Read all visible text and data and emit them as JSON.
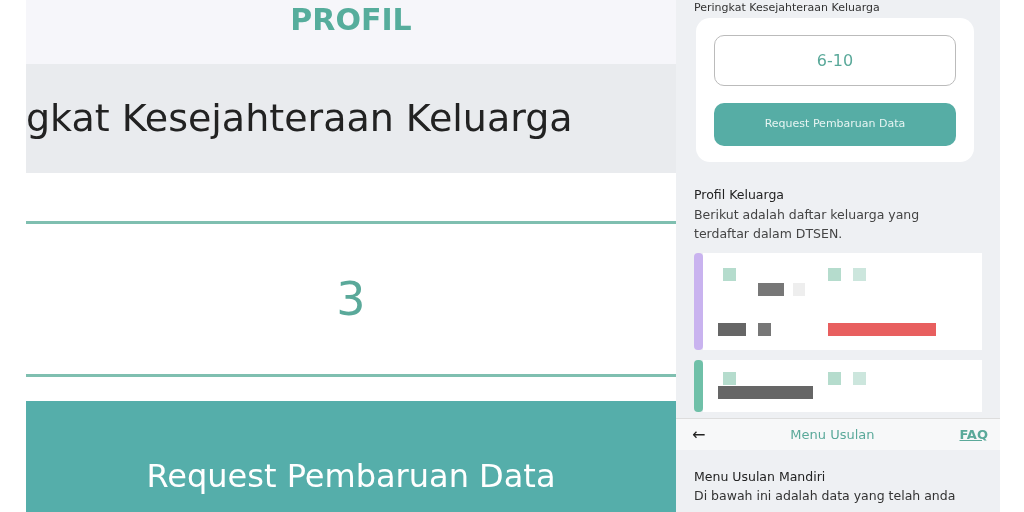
{
  "left_screen": {
    "title": "PROFIL",
    "heading": "gkat Kesejahteraan Keluarga",
    "value": "3",
    "button": "Request Pembaruan Data"
  },
  "right_screen": {
    "section_label": "Peringkat Kesejahteraan Keluarga",
    "value": "6-10",
    "button": "Request Pembaruan Data",
    "family_profile": {
      "title": "Profil Keluarga",
      "description": "Berikut adalah daftar keluarga yang terdaftar dalam DTSEN.",
      "cards": [
        {
          "color": "#c9b3ef"
        },
        {
          "color": "#6fc0a8"
        }
      ]
    },
    "nav": {
      "back": "←",
      "title": "Menu Usulan",
      "faq": "FAQ"
    },
    "menu_section": {
      "title": "Menu Usulan Mandiri",
      "description": "Di bawah ini adalah data yang telah anda"
    }
  }
}
